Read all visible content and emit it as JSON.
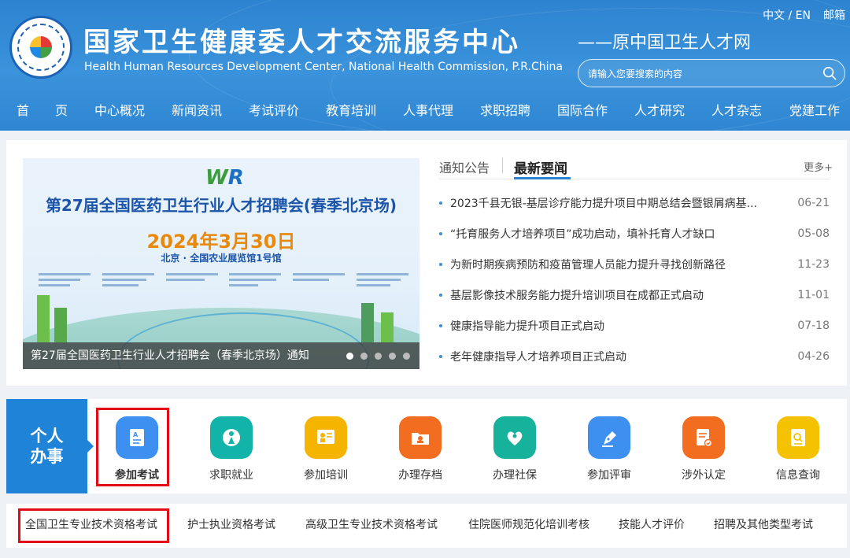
{
  "header": {
    "org_name_cn": "国家卫生健康委人才交流服务中心",
    "org_name_en": "Health Human Resources Development Center, National Health Commission, P.R.China",
    "former_name": "——原中国卫生人才网",
    "lang_label": "中文 / EN",
    "mail_label": "邮箱",
    "search_placeholder": "请输入您要搜索的内容"
  },
  "nav": {
    "items": [
      "首",
      "页",
      "中心概况",
      "新闻资讯",
      "考试评价",
      "教育培训",
      "人事代理",
      "求职招聘",
      "国际合作",
      "人才研究",
      "人才杂志",
      "党建工作"
    ]
  },
  "banner": {
    "logo_text_a": "W",
    "logo_text_b": "R",
    "title": "第27届全国医药卫生行业人才招聘会(春季北京场)",
    "date": "2024年3月30日",
    "venue": "北京 · 全国农业展览馆1号馆",
    "caption": "第27届全国医药卫生行业人才招聘会（春季北京场）通知",
    "slide_count": 5,
    "active_slide": 1
  },
  "news": {
    "tab_notice": "通知公告",
    "tab_latest": "最新要闻",
    "more": "更多+",
    "items": [
      {
        "title": "2023千县无银-基层诊疗能力提升项目中期总结会暨银屑病基...",
        "date": "06-21"
      },
      {
        "title": "“托育服务人才培养项目”成功启动，填补托育人才缺口",
        "date": "05-08"
      },
      {
        "title": "为新时期疾病预防和疫苗管理人员能力提升寻找创新路径",
        "date": "11-23"
      },
      {
        "title": "基层影像技术服务能力提升培训项目在成都正式启动",
        "date": "11-01"
      },
      {
        "title": "健康指导能力提升项目正式启动",
        "date": "07-18"
      },
      {
        "title": "老年健康指导人才培养项目正式启动",
        "date": "04-26"
      }
    ]
  },
  "services": {
    "label_line1": "个人",
    "label_line2": "办事",
    "items": [
      {
        "label": "参加考试",
        "color": "#3d8ff0",
        "icon": "exam-icon"
      },
      {
        "label": "求职就业",
        "color": "#12b3a8",
        "icon": "job-icon"
      },
      {
        "label": "参加培训",
        "color": "#f4b400",
        "icon": "training-icon"
      },
      {
        "label": "办理存档",
        "color": "#f36d21",
        "icon": "archive-icon"
      },
      {
        "label": "办理社保",
        "color": "#17b29c",
        "icon": "social-security-icon"
      },
      {
        "label": "参加评审",
        "color": "#3d8ff0",
        "icon": "review-icon"
      },
      {
        "label": "涉外认定",
        "color": "#f36d21",
        "icon": "foreign-cert-icon"
      },
      {
        "label": "信息查询",
        "color": "#f4c200",
        "icon": "info-query-icon"
      }
    ]
  },
  "exams": {
    "items": [
      "全国卫生专业技术资格考试",
      "护士执业资格考试",
      "高级卫生专业技术资格考试",
      "住院医师规范化培训考核",
      "技能人才评价",
      "招聘及其他类型考试"
    ]
  }
}
